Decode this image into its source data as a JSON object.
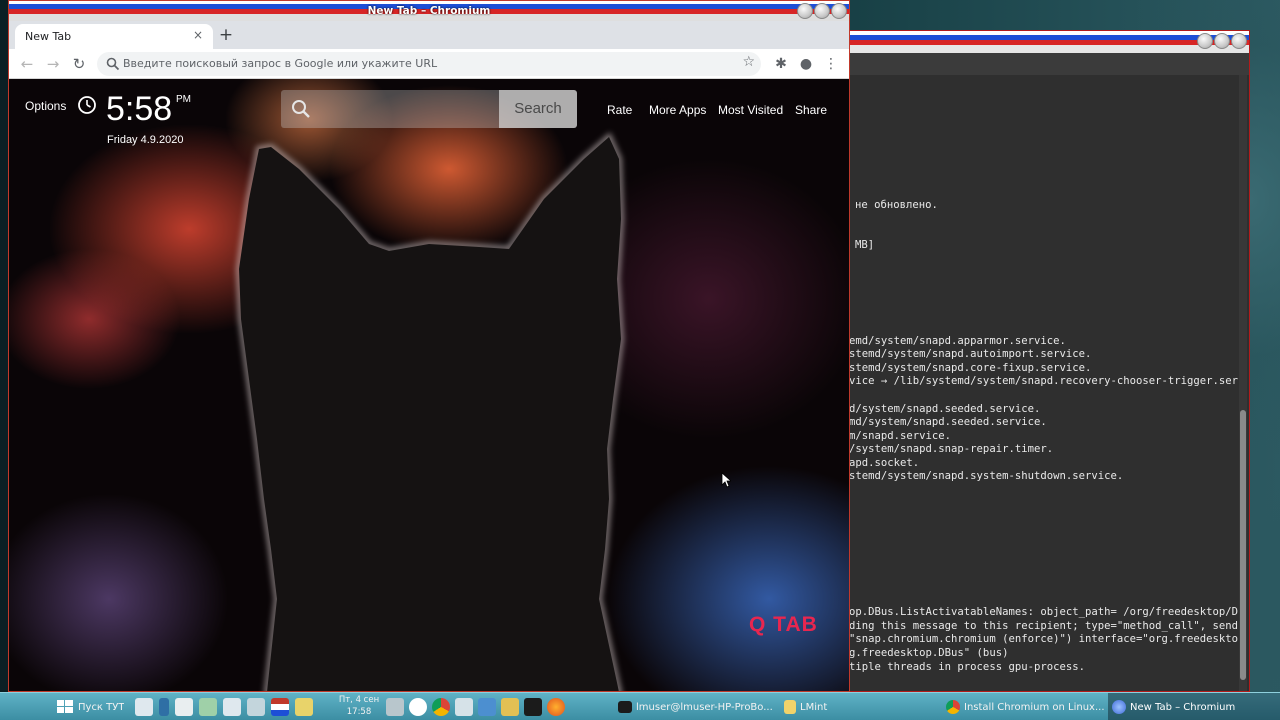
{
  "chrome": {
    "window_title": "New Tab – Chromium",
    "tab_title": "New Tab",
    "tab_close": "×",
    "new_tab": "+",
    "back": "←",
    "forward": "→",
    "reload": "↻",
    "omnibox_placeholder": "Введите поисковый запрос в Google или укажите URL",
    "star": "☆",
    "extensions": "✱",
    "profile": "●",
    "menu": "⋮"
  },
  "newtab": {
    "options_label": "Options",
    "time": "5:58",
    "ampm": "PM",
    "date": "Friday  4.9.2020",
    "search_button": "Search",
    "links": {
      "rate": "Rate",
      "more_apps": "More Apps",
      "most_visited": "Most Visited",
      "share": "Share"
    },
    "logo": "Q TAB"
  },
  "terminal": {
    "lines": [
      "не обновлено.",
      "MB]",
      "emd/system/snapd.apparmor.service.",
      "stemd/system/snapd.autoimport.service.",
      "stemd/system/snapd.core-fixup.service.",
      "vice → /lib/systemd/system/snapd.recovery-chooser-trigger.ser",
      "d/system/snapd.seeded.service.",
      "md/system/snapd.seeded.service.",
      "m/snapd.service.",
      "/system/snapd.snap-repair.timer.",
      "apd.socket.",
      "stemd/system/snapd.system-shutdown.service.",
      "op.DBus.ListActivatableNames: object_path= /org/freedesktop/D",
      "ding this message to this recipient; type=\"method_call\", send",
      "\"snap.chromium.chromium (enforce)\") interface=\"org.freedeskto",
      "g.freedesktop.DBus\" (bus)",
      "tiple threads in process gpu-process."
    ]
  },
  "taskbar": {
    "start_label": "Пуск ТУТ",
    "clock_line1": "Пт, 4 сен",
    "clock_line2": "17:58",
    "tasks": [
      "lmuser@lmuser-HP-ProBo...",
      "LMint",
      "Install Chromium on Linux...",
      "New Tab – Chromium"
    ]
  },
  "colors": {
    "accent_red": "#d72525",
    "accent_blue": "#1d4fd6",
    "qtab_pink": "#e8264f",
    "taskbar": "#4aa0b5"
  }
}
